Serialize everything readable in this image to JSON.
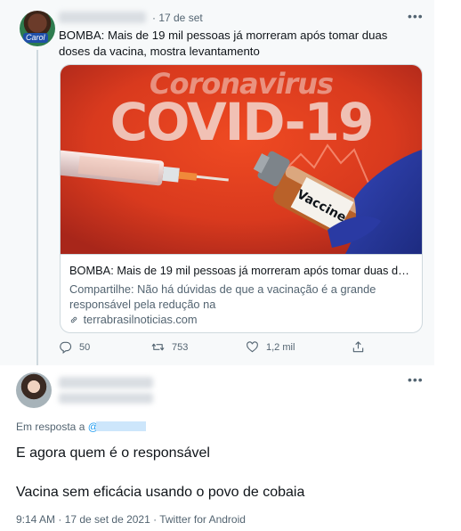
{
  "tweet": {
    "date": "· 17 de set",
    "text": "BOMBA: Mais de 19 mil pessoas já morreram após tomar duas doses da vacina, mostra levantamento",
    "avatar_tag": "Carol",
    "card": {
      "image_text_top": "Coronavirus",
      "image_text_main": "COVID-19",
      "image_vial_label": "Vaccine",
      "title": "BOMBA: Mais de 19 mil pessoas já morreram após tomar duas doses...",
      "description": "Compartilhe: Não há dúvidas de que a vacinação é a grande responsável pela redução na",
      "domain": "terrabrasilnoticias.com"
    },
    "actions": {
      "reply_icon": "reply-icon",
      "reply_count": "50",
      "retweet_icon": "retweet-icon",
      "retweet_count": "753",
      "like_icon": "heart-icon",
      "like_count": "1,2 mil",
      "share_icon": "share-icon"
    }
  },
  "reply": {
    "replying_to_label": "Em resposta a",
    "replying_to_at": "@",
    "line1": "E agora quem é o responsável",
    "line2": "Vacina sem eficácia usando o povo de cobaia",
    "meta": "9:14 AM · 17 de set de 2021 · Twitter for Android"
  },
  "more_icon": "more-dots-icon",
  "colors": {
    "text_primary": "#0f1419",
    "text_secondary": "#536471",
    "link_blue": "#1d9bf0",
    "thread_line": "#cfd9de",
    "card_image_red": "#d93a1e"
  }
}
